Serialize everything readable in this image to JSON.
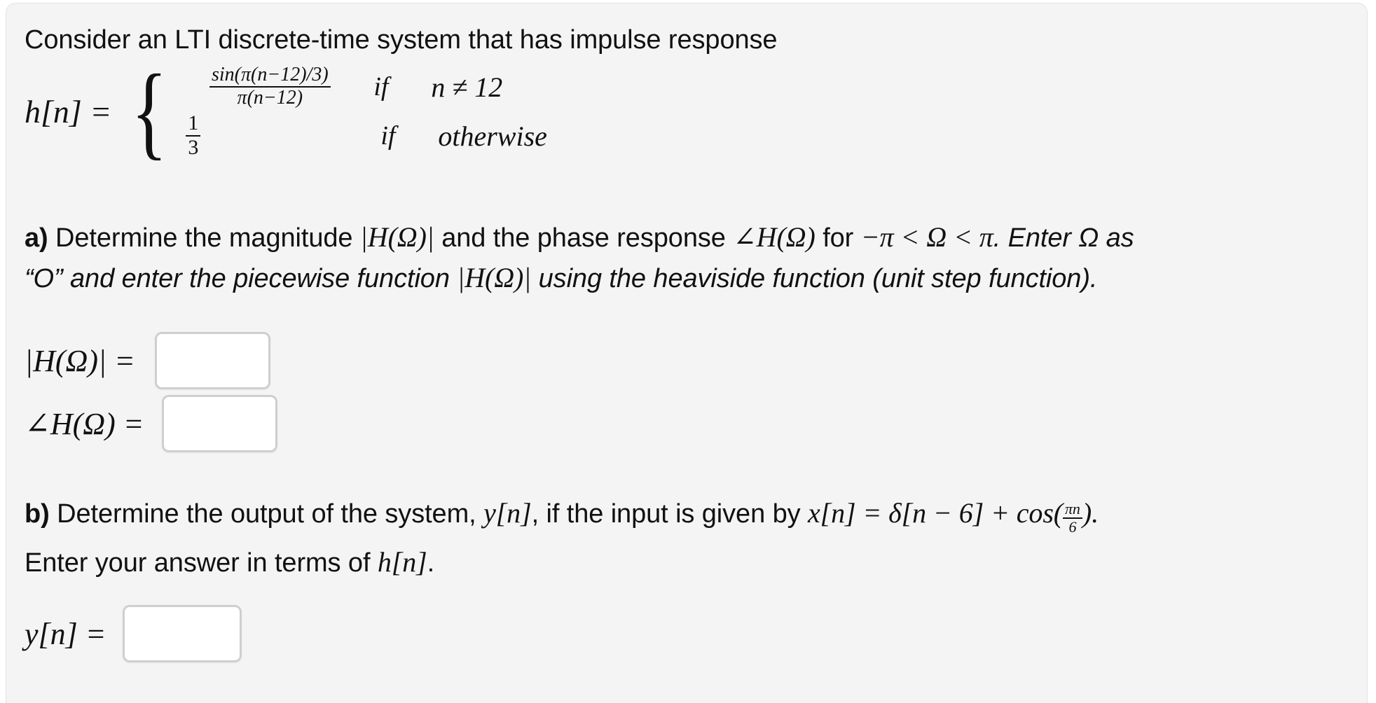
{
  "page": {
    "background": "#ffffff",
    "card_background": "#f4f4f4",
    "card_border": "#e3e3e3",
    "text_color": "#111111",
    "input_border_color": "#cfcfcf",
    "input_background": "#ffffff"
  },
  "intro": {
    "text": "Consider an LTI discrete-time system that has impulse response"
  },
  "impulse_response": {
    "lhs": "h[n] =",
    "brace": "{",
    "cases": [
      {
        "value_numerator": "sin(π(n−12)/3)",
        "value_denominator": "π(n−12)",
        "if_word": "if",
        "condition": "n ≠ 12"
      },
      {
        "value_numerator": "1",
        "value_denominator": "3",
        "if_word": "if",
        "condition": "otherwise"
      }
    ]
  },
  "part_a": {
    "label": "a)",
    "line1_part1": " Determine the magnitude ",
    "line1_math1": "|H(Ω)|",
    "line1_part2": " and the phase response ",
    "line1_math2": "∠H(Ω)",
    "line1_part3": " for ",
    "line1_math3": "−π < Ω < π",
    "line1_part4": ". Enter Ω as",
    "line2_part1": "“O” and enter the piecewise function ",
    "line2_math1": "|H(Ω)|",
    "line2_part2": " using the heaviside function (unit step function).",
    "answers": [
      {
        "label": "|H(Ω)| =",
        "value": "",
        "placeholder": ""
      },
      {
        "label": "∠H(Ω) =",
        "value": "",
        "placeholder": ""
      }
    ]
  },
  "part_b": {
    "label": "b)",
    "line1_part1": " Determine the output of the system, ",
    "line1_math1": "y[n]",
    "line1_part2": ", if the input is given by ",
    "line1_math2": "x[n] = δ[n − 6] + cos(",
    "line1_frac_num": "πn",
    "line1_frac_den": "6",
    "line1_part3": ").",
    "line2": "Enter your answer in terms of ",
    "line2_math": "h[n]",
    "line2_end": ".",
    "answers": [
      {
        "label": "y[n] =",
        "value": "",
        "placeholder": ""
      }
    ]
  }
}
